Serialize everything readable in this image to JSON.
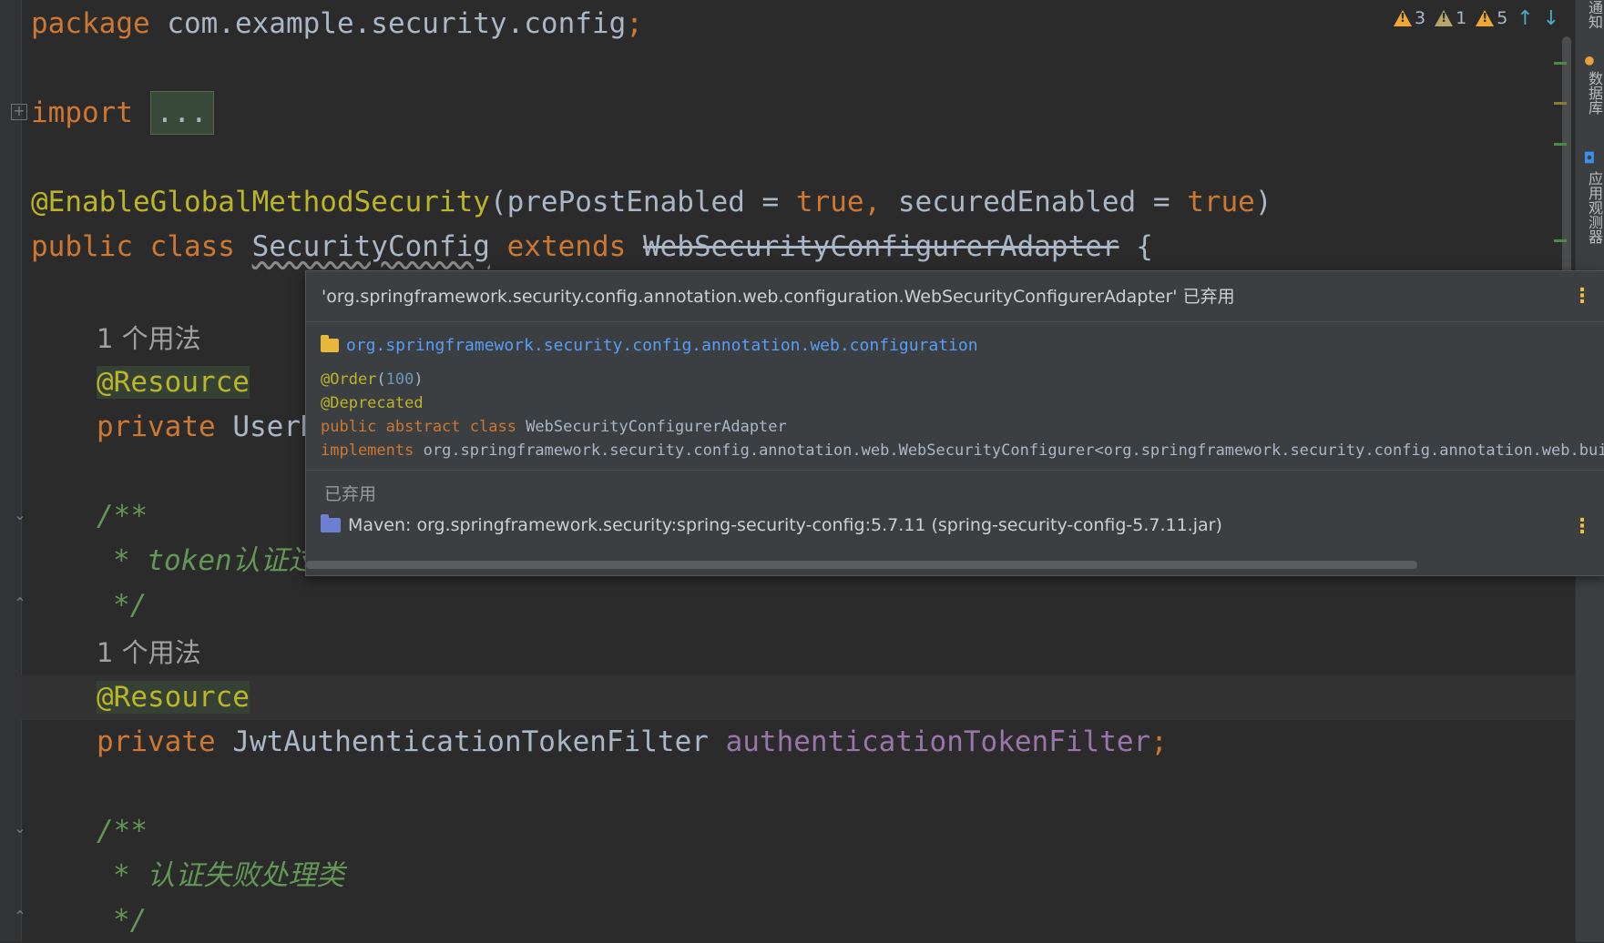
{
  "code": {
    "line_package": {
      "kw": "package",
      "name": "com.example.security.config",
      "semi": ";"
    },
    "line_import": {
      "kw": "import",
      "folded": "..."
    },
    "line_annotation": {
      "ann": "@EnableGlobalMethodSecurity",
      "open": "(",
      "p1": "prePostEnabled",
      "eq1": " = ",
      "v1": "true",
      "comma": ",",
      "p2": "securedEnabled",
      "eq2": " = ",
      "v2": "true",
      "close": ")"
    },
    "line_class": {
      "mod": "public",
      "cls_kw": "class",
      "name": "SecurityConfig",
      "ext": "extends",
      "parent": "WebSecurityConfigurerAdapter",
      "brace": "{"
    },
    "usage_1": "1 个用法",
    "resource_1": "@Resource",
    "field_1_partial": {
      "kw": "private",
      "type": "UserD"
    },
    "comment_1": {
      "open": "/**",
      "body": "* token认证过",
      "close": "*/"
    },
    "usage_2": "1 个用法",
    "resource_2": "@Resource",
    "field_2": {
      "kw": "private",
      "type": "JwtAuthenticationTokenFilter",
      "name": "authenticationTokenFilter",
      "semi": ";"
    },
    "comment_2": {
      "open": "/**",
      "body": "* 认证失败处理类",
      "close": "*/"
    }
  },
  "inspections": {
    "warnings": "3",
    "weak_warnings": "1",
    "typos": "5",
    "prev_icon": "arrow-up-icon",
    "next_icon": "arrow-down-icon"
  },
  "tool_strip": {
    "notifications": "通知",
    "database": "数据库",
    "app_inspector": "应用观测器"
  },
  "popup": {
    "header": "'org.springframework.security.config.annotation.web.configuration.WebSecurityConfigurerAdapter' 已弃用",
    "package": "org.springframework.security.config.annotation.web.configuration",
    "order_ann": "@Order",
    "order_paren_open": "(",
    "order_value": "100",
    "order_paren_close": ")",
    "deprecated_ann": "@Deprecated",
    "decl_mods": "public abstract class",
    "decl_name": "WebSecurityConfigurerAdapter",
    "implements_kw": "implements",
    "implements_value": "org.springframework.security.config.annotation.web.WebSecurityConfigurer<org.springframework.security.config.annotation.web.build",
    "deprecated_label": "已弃用",
    "library": "Maven: org.springframework.security:spring-security-config:5.7.11 (spring-security-config-5.7.11.jar)"
  },
  "colors": {
    "background": "#2b2b2b",
    "keyword": "#cc7832",
    "annotation": "#bbb529",
    "field": "#9876aa",
    "comment": "#629755",
    "link": "#589df6"
  }
}
